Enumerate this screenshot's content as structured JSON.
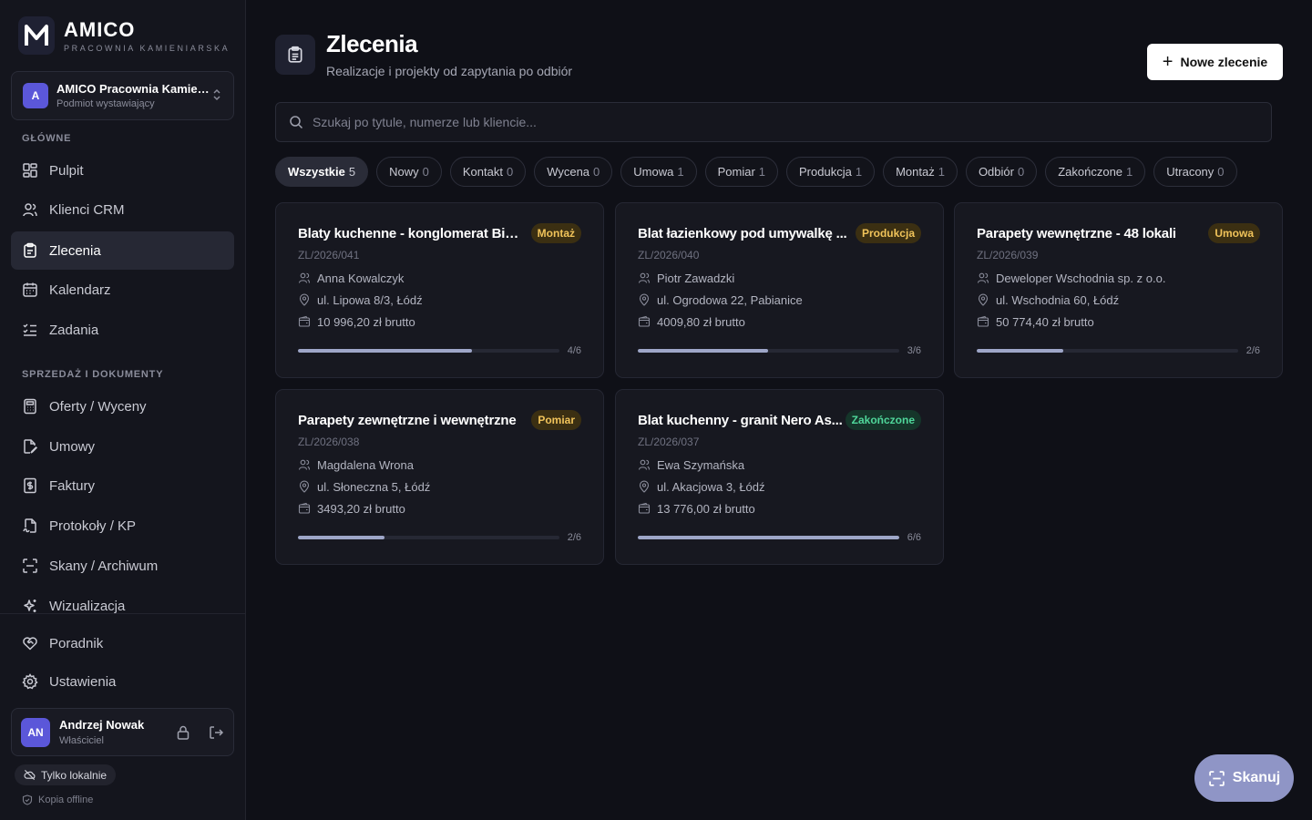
{
  "brand": {
    "logo_letter": "M",
    "name": "AMICO",
    "subtitle": "PRACOWNIA KAMIENIARSKA"
  },
  "entity": {
    "avatar": "A",
    "name": "AMICO Pracownia Kamieniarska",
    "role": "Podmiot wystawiający"
  },
  "sidebar": {
    "section_main": "GŁÓWNE",
    "section_sales": "SPRZEDAŻ I DOKUMENTY",
    "items": [
      {
        "label": "Pulpit",
        "icon": "dashboard-icon"
      },
      {
        "label": "Klienci CRM",
        "icon": "users-icon"
      },
      {
        "label": "Zlecenia",
        "icon": "clipboard-icon",
        "active": true
      },
      {
        "label": "Kalendarz",
        "icon": "calendar-icon"
      },
      {
        "label": "Zadania",
        "icon": "list-checks-icon"
      },
      {
        "label": "Oferty / Wyceny",
        "icon": "calculator-icon"
      },
      {
        "label": "Umowy",
        "icon": "file-pen-icon"
      },
      {
        "label": "Faktury",
        "icon": "receipt-icon"
      },
      {
        "label": "Protokoły / KP",
        "icon": "file-signature-icon"
      },
      {
        "label": "Skany / Archiwum",
        "icon": "scan-icon"
      },
      {
        "label": "Wizualizacja",
        "icon": "sparkles-icon"
      },
      {
        "label": "Poradnik",
        "icon": "handshake-icon"
      },
      {
        "label": "Ustawienia",
        "icon": "gear-icon"
      }
    ]
  },
  "user": {
    "initials": "AN",
    "name": "Andrzej Nowak",
    "role": "Właściciel"
  },
  "status": {
    "local_label": "Tylko lokalnie",
    "offline_label": "Kopia offline"
  },
  "header": {
    "title": "Zlecenia",
    "subtitle": "Realizacje i projekty od zapytania po odbiór",
    "new_button": "Nowe zlecenie"
  },
  "search": {
    "placeholder": "Szukaj po tytule, numerze lub kliencie..."
  },
  "filters": [
    {
      "label": "Wszystkie",
      "count": "5",
      "active": true
    },
    {
      "label": "Nowy",
      "count": "0"
    },
    {
      "label": "Kontakt",
      "count": "0"
    },
    {
      "label": "Wycena",
      "count": "0"
    },
    {
      "label": "Umowa",
      "count": "1"
    },
    {
      "label": "Pomiar",
      "count": "1"
    },
    {
      "label": "Produkcja",
      "count": "1"
    },
    {
      "label": "Montaż",
      "count": "1"
    },
    {
      "label": "Odbiór",
      "count": "0"
    },
    {
      "label": "Zakończone",
      "count": "1"
    },
    {
      "label": "Utracony",
      "count": "0"
    }
  ],
  "orders": [
    {
      "title": "Blaty kuchenne - konglomerat Bia...",
      "status": "Montaż",
      "status_color": "#f0c35a",
      "number": "ZL/2026/041",
      "client": "Anna Kowalczyk",
      "address": "ul. Lipowa 8/3, Łódź",
      "price": "10 996,20 zł brutto",
      "progress_label": "4/6",
      "progress": 0.667
    },
    {
      "title": "Blat łazienkowy pod umywalkę ...",
      "status": "Produkcja",
      "status_color": "#f0c35a",
      "number": "ZL/2026/040",
      "client": "Piotr Zawadzki",
      "address": "ul. Ogrodowa 22, Pabianice",
      "price": "4009,80 zł brutto",
      "progress_label": "3/6",
      "progress": 0.5
    },
    {
      "title": "Parapety wewnętrzne - 48 lokali",
      "status": "Umowa",
      "status_color": "#f0c35a",
      "number": "ZL/2026/039",
      "client": "Deweloper Wschodnia sp. z o.o.",
      "address": "ul. Wschodnia 60, Łódź",
      "price": "50 774,40 zł brutto",
      "progress_label": "2/6",
      "progress": 0.333
    },
    {
      "title": "Parapety zewnętrzne i wewnętrzne",
      "status": "Pomiar",
      "status_color": "#f0c35a",
      "number": "ZL/2026/038",
      "client": "Magdalena Wrona",
      "address": "ul. Słoneczna 5, Łódź",
      "price": "3493,20 zł brutto",
      "progress_label": "2/6",
      "progress": 0.333
    },
    {
      "title": "Blat kuchenny - granit Nero As...",
      "status": "Zakończone",
      "status_color": "#4fd69a",
      "number": "ZL/2026/037",
      "client": "Ewa Szymańska",
      "address": "ul. Akacjowa 3, Łódź",
      "price": "13 776,00 zł brutto",
      "progress_label": "6/6",
      "progress": 1.0
    }
  ],
  "scan_button": "Skanuj"
}
